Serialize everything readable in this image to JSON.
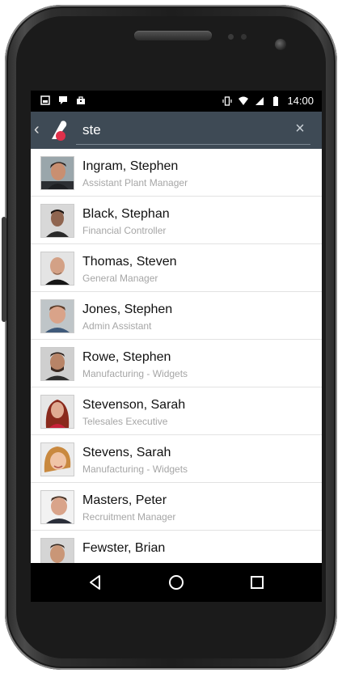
{
  "status_bar": {
    "time": "14:00"
  },
  "search": {
    "value": "ste",
    "clear_icon": "close-icon"
  },
  "contacts": [
    {
      "name": "Ingram, Stephen",
      "role": "Assistant Plant Manager"
    },
    {
      "name": "Black, Stephan",
      "role": "Financial Controller"
    },
    {
      "name": "Thomas, Steven",
      "role": "General Manager"
    },
    {
      "name": "Jones, Stephen",
      "role": "Admin Assistant"
    },
    {
      "name": "Rowe, Stephen",
      "role": "Manufacturing - Widgets"
    },
    {
      "name": "Stevenson, Sarah",
      "role": "Telesales Executive"
    },
    {
      "name": "Stevens, Sarah",
      "role": "Manufacturing - Widgets"
    },
    {
      "name": "Masters, Peter",
      "role": "Recruitment Manager"
    },
    {
      "name": "Fewster, Brian",
      "role": ""
    }
  ],
  "colors": {
    "app_bar": "#3e4a55",
    "status_bar": "#000000",
    "nav_bar": "#000000",
    "accent": "#e0314b"
  }
}
